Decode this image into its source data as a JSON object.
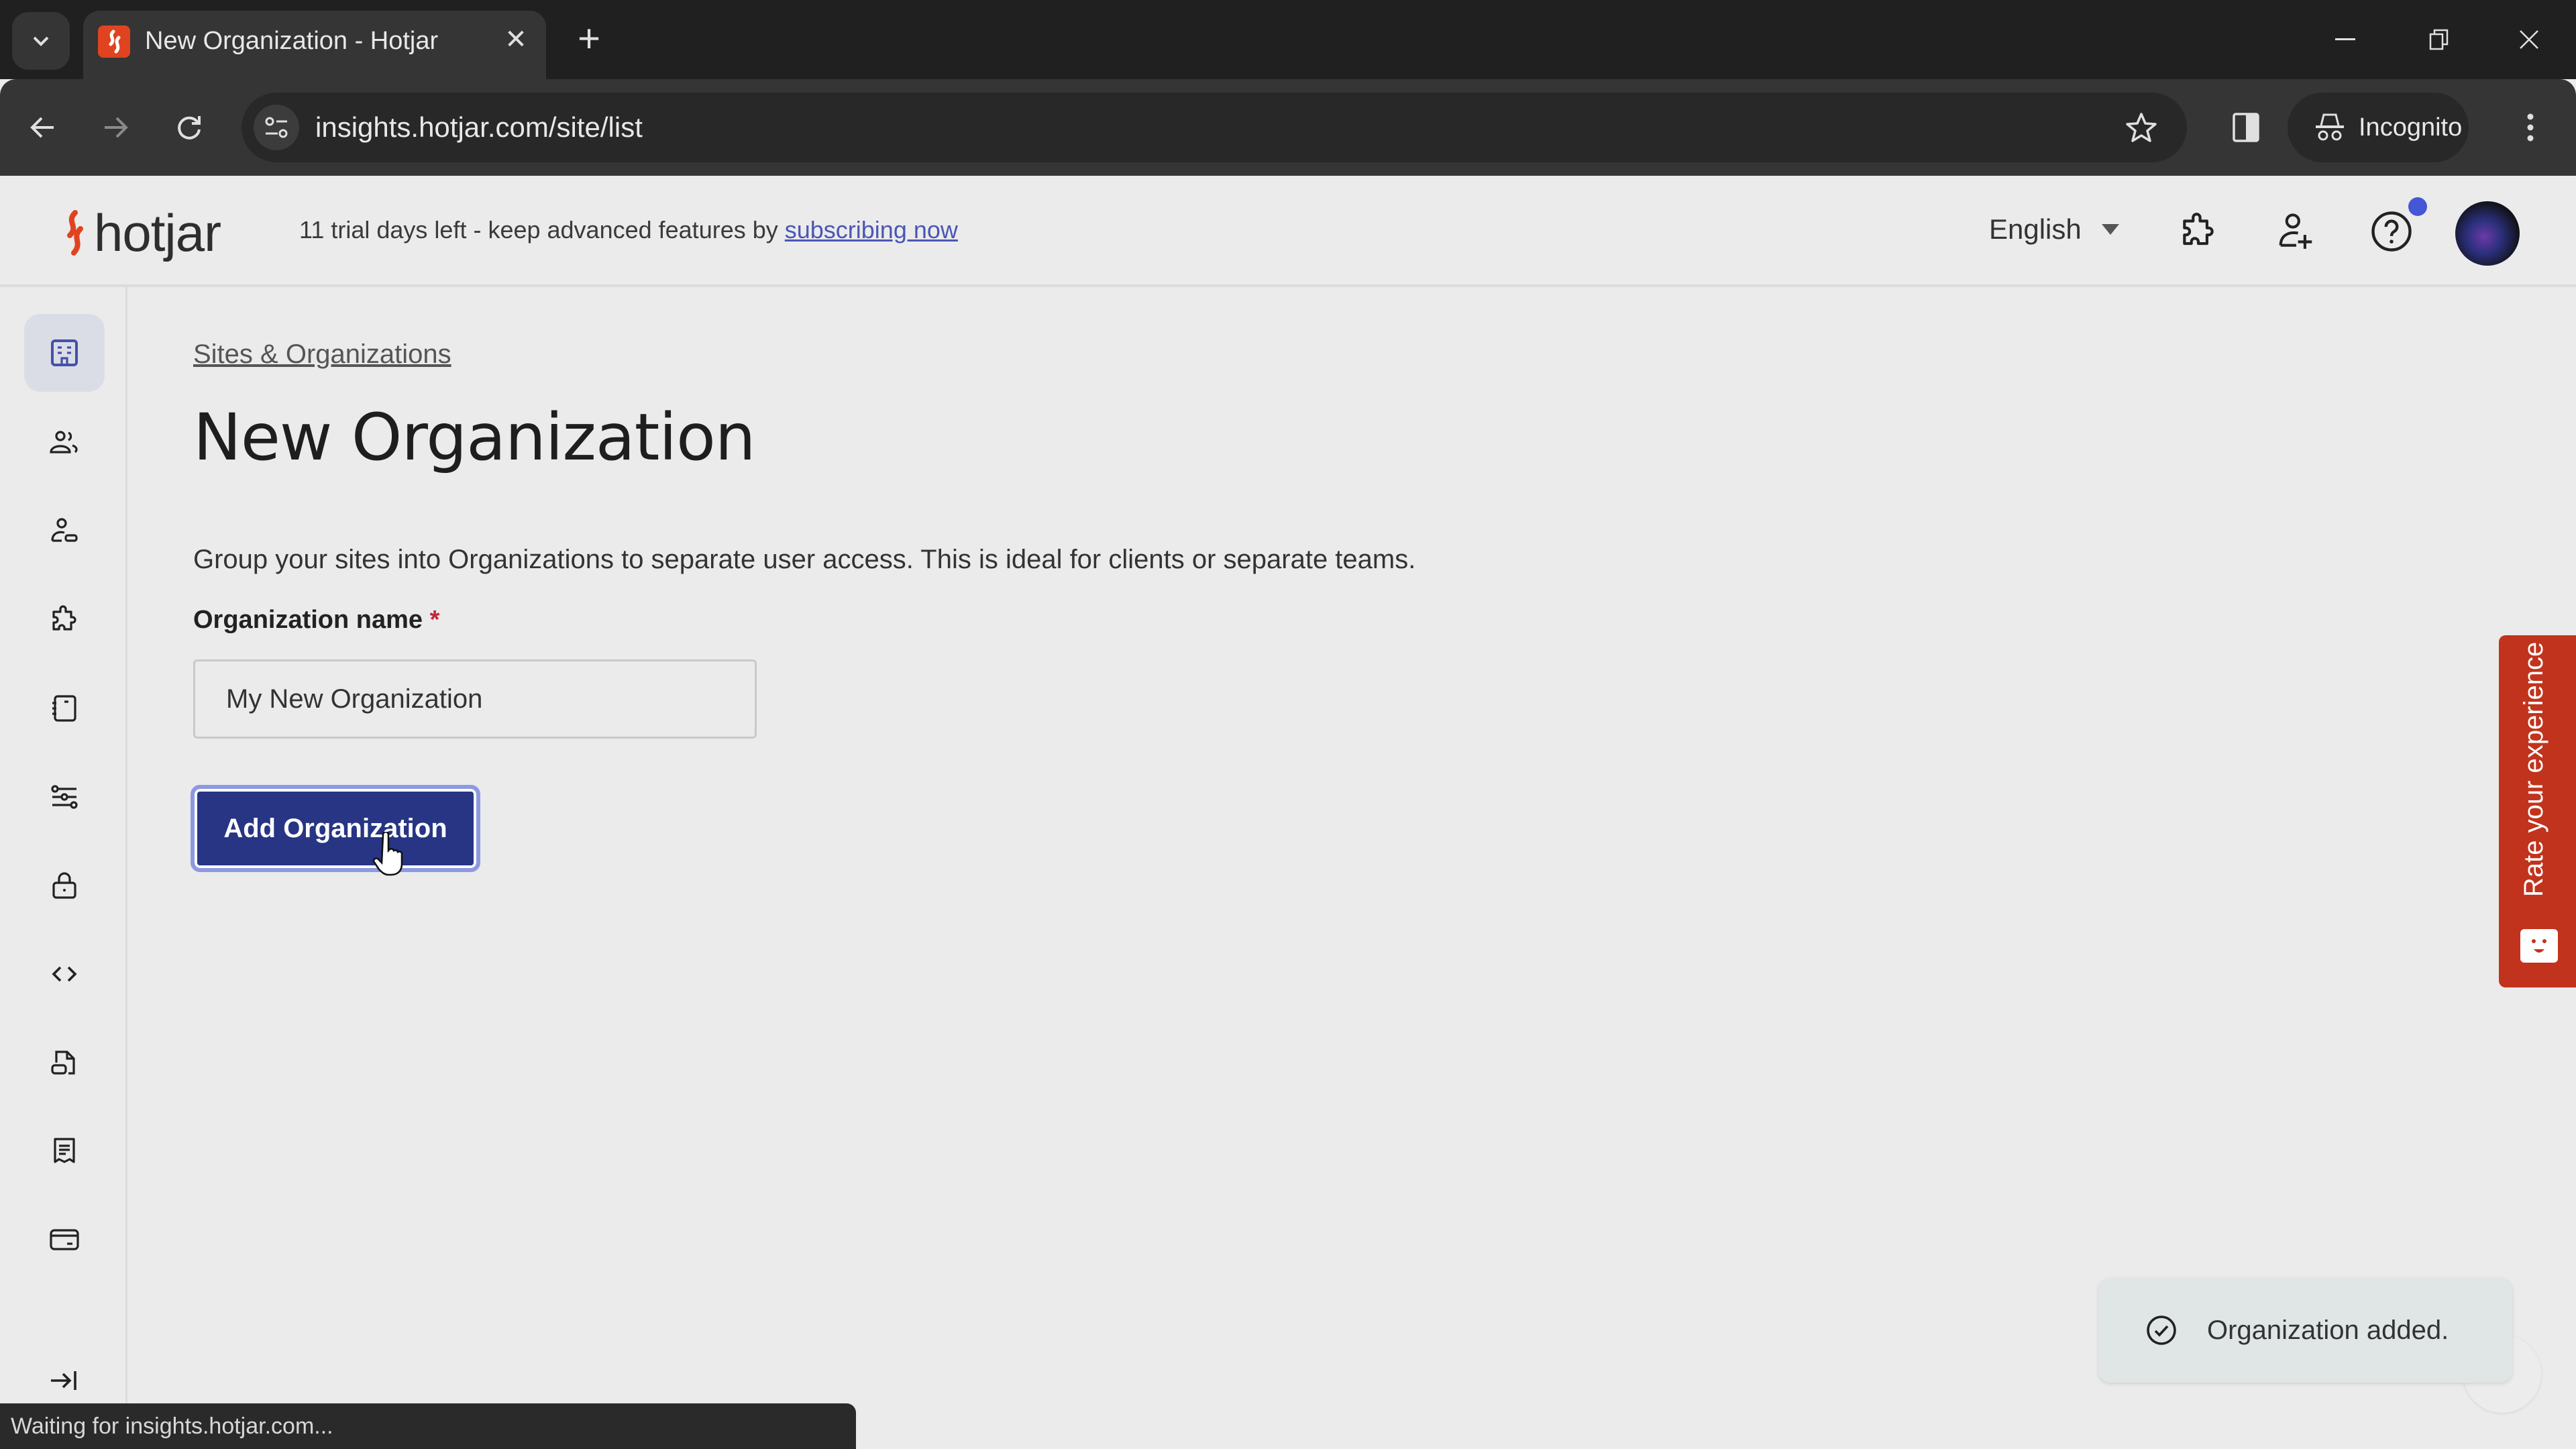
{
  "browser": {
    "tab_title": "New Organization - Hotjar",
    "url": "insights.hotjar.com/site/list",
    "incognito_label": "Incognito",
    "status_text": "Waiting for insights.hotjar.com..."
  },
  "header": {
    "logo_text": "hotjar",
    "trial_text": "11 trial days left - keep advanced features by ",
    "trial_link": "subscribing now",
    "language": "English"
  },
  "sidebar": {
    "items": [
      {
        "icon": "building-icon",
        "active": true
      },
      {
        "icon": "users-icon"
      },
      {
        "icon": "user-badge-icon"
      },
      {
        "icon": "puzzle-icon"
      },
      {
        "icon": "notebook-icon"
      },
      {
        "icon": "sliders-icon"
      },
      {
        "icon": "lock-icon"
      },
      {
        "icon": "code-icon"
      },
      {
        "icon": "file-icon"
      },
      {
        "icon": "receipt-icon"
      },
      {
        "icon": "credit-card-icon"
      }
    ],
    "collapse_icon": "collapse-arrow-icon"
  },
  "main": {
    "breadcrumb": "Sites & Organizations",
    "title": "New Organization",
    "description": "Group your sites into Organizations to separate user access. This is ideal for clients or separate teams.",
    "field_label": "Organization name",
    "required_mark": "*",
    "field_value": "My New Organization",
    "submit_label": "Add Organization"
  },
  "feedback": {
    "rate_label": "Rate your experience"
  },
  "toast": {
    "message": "Organization added."
  },
  "colors": {
    "brand_orange": "#e0431f",
    "primary_button": "#273584",
    "rate_button": "#c1331c",
    "link": "#4a56b5"
  }
}
